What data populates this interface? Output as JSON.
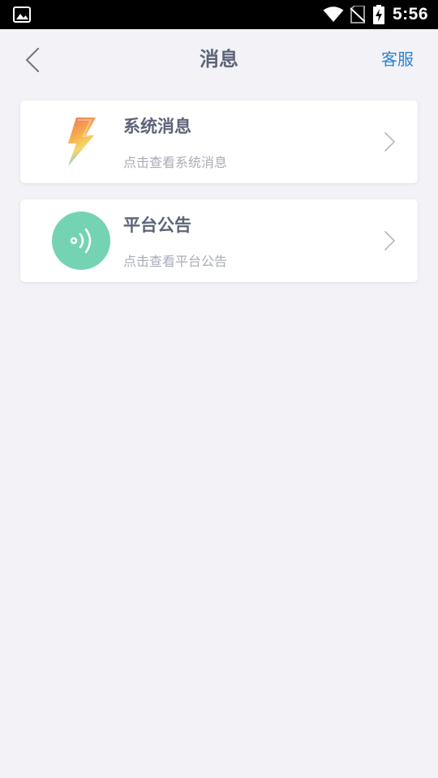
{
  "status_bar": {
    "time": "5:56",
    "icons": [
      "gallery-icon",
      "wifi-icon",
      "no-sim-icon",
      "battery-charging-icon"
    ]
  },
  "header": {
    "back_icon": "chevron-left-icon",
    "title": "消息",
    "service_label": "客服"
  },
  "messages": [
    {
      "icon": "lightning-icon",
      "title": "系统消息",
      "subtitle": "点击查看系统消息"
    },
    {
      "icon": "broadcast-icon",
      "title": "平台公告",
      "subtitle": "点击查看平台公告"
    }
  ],
  "colors": {
    "page_background": "#f2f2f7",
    "title_text": "#5e6378",
    "subtitle_text": "#a9acb8",
    "accent_link": "#2d83d4",
    "broadcast_green": "#74d3b3"
  }
}
